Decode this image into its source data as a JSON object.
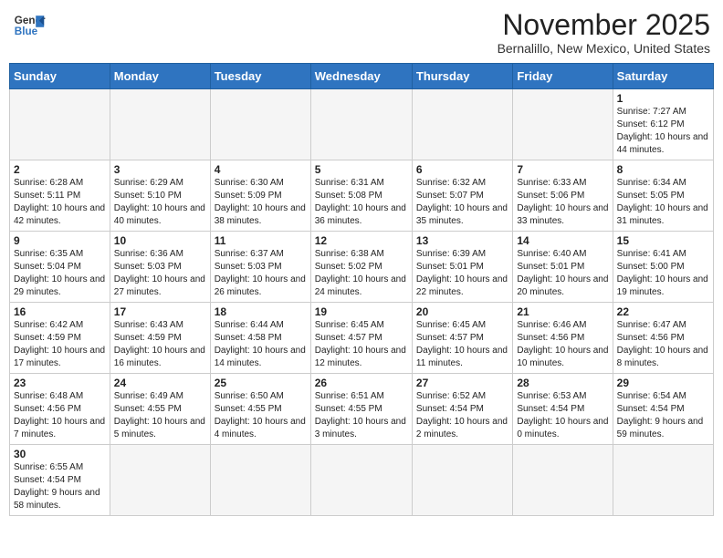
{
  "header": {
    "logo_general": "General",
    "logo_blue": "Blue",
    "month_title": "November 2025",
    "location": "Bernalillo, New Mexico, United States"
  },
  "days_of_week": [
    "Sunday",
    "Monday",
    "Tuesday",
    "Wednesday",
    "Thursday",
    "Friday",
    "Saturday"
  ],
  "weeks": [
    [
      {
        "day": "",
        "info": ""
      },
      {
        "day": "",
        "info": ""
      },
      {
        "day": "",
        "info": ""
      },
      {
        "day": "",
        "info": ""
      },
      {
        "day": "",
        "info": ""
      },
      {
        "day": "",
        "info": ""
      },
      {
        "day": "1",
        "info": "Sunrise: 7:27 AM\nSunset: 6:12 PM\nDaylight: 10 hours and 44 minutes."
      }
    ],
    [
      {
        "day": "2",
        "info": "Sunrise: 6:28 AM\nSunset: 5:11 PM\nDaylight: 10 hours and 42 minutes."
      },
      {
        "day": "3",
        "info": "Sunrise: 6:29 AM\nSunset: 5:10 PM\nDaylight: 10 hours and 40 minutes."
      },
      {
        "day": "4",
        "info": "Sunrise: 6:30 AM\nSunset: 5:09 PM\nDaylight: 10 hours and 38 minutes."
      },
      {
        "day": "5",
        "info": "Sunrise: 6:31 AM\nSunset: 5:08 PM\nDaylight: 10 hours and 36 minutes."
      },
      {
        "day": "6",
        "info": "Sunrise: 6:32 AM\nSunset: 5:07 PM\nDaylight: 10 hours and 35 minutes."
      },
      {
        "day": "7",
        "info": "Sunrise: 6:33 AM\nSunset: 5:06 PM\nDaylight: 10 hours and 33 minutes."
      },
      {
        "day": "8",
        "info": "Sunrise: 6:34 AM\nSunset: 5:05 PM\nDaylight: 10 hours and 31 minutes."
      }
    ],
    [
      {
        "day": "9",
        "info": "Sunrise: 6:35 AM\nSunset: 5:04 PM\nDaylight: 10 hours and 29 minutes."
      },
      {
        "day": "10",
        "info": "Sunrise: 6:36 AM\nSunset: 5:03 PM\nDaylight: 10 hours and 27 minutes."
      },
      {
        "day": "11",
        "info": "Sunrise: 6:37 AM\nSunset: 5:03 PM\nDaylight: 10 hours and 26 minutes."
      },
      {
        "day": "12",
        "info": "Sunrise: 6:38 AM\nSunset: 5:02 PM\nDaylight: 10 hours and 24 minutes."
      },
      {
        "day": "13",
        "info": "Sunrise: 6:39 AM\nSunset: 5:01 PM\nDaylight: 10 hours and 22 minutes."
      },
      {
        "day": "14",
        "info": "Sunrise: 6:40 AM\nSunset: 5:01 PM\nDaylight: 10 hours and 20 minutes."
      },
      {
        "day": "15",
        "info": "Sunrise: 6:41 AM\nSunset: 5:00 PM\nDaylight: 10 hours and 19 minutes."
      }
    ],
    [
      {
        "day": "16",
        "info": "Sunrise: 6:42 AM\nSunset: 4:59 PM\nDaylight: 10 hours and 17 minutes."
      },
      {
        "day": "17",
        "info": "Sunrise: 6:43 AM\nSunset: 4:59 PM\nDaylight: 10 hours and 16 minutes."
      },
      {
        "day": "18",
        "info": "Sunrise: 6:44 AM\nSunset: 4:58 PM\nDaylight: 10 hours and 14 minutes."
      },
      {
        "day": "19",
        "info": "Sunrise: 6:45 AM\nSunset: 4:57 PM\nDaylight: 10 hours and 12 minutes."
      },
      {
        "day": "20",
        "info": "Sunrise: 6:45 AM\nSunset: 4:57 PM\nDaylight: 10 hours and 11 minutes."
      },
      {
        "day": "21",
        "info": "Sunrise: 6:46 AM\nSunset: 4:56 PM\nDaylight: 10 hours and 10 minutes."
      },
      {
        "day": "22",
        "info": "Sunrise: 6:47 AM\nSunset: 4:56 PM\nDaylight: 10 hours and 8 minutes."
      }
    ],
    [
      {
        "day": "23",
        "info": "Sunrise: 6:48 AM\nSunset: 4:56 PM\nDaylight: 10 hours and 7 minutes."
      },
      {
        "day": "24",
        "info": "Sunrise: 6:49 AM\nSunset: 4:55 PM\nDaylight: 10 hours and 5 minutes."
      },
      {
        "day": "25",
        "info": "Sunrise: 6:50 AM\nSunset: 4:55 PM\nDaylight: 10 hours and 4 minutes."
      },
      {
        "day": "26",
        "info": "Sunrise: 6:51 AM\nSunset: 4:55 PM\nDaylight: 10 hours and 3 minutes."
      },
      {
        "day": "27",
        "info": "Sunrise: 6:52 AM\nSunset: 4:54 PM\nDaylight: 10 hours and 2 minutes."
      },
      {
        "day": "28",
        "info": "Sunrise: 6:53 AM\nSunset: 4:54 PM\nDaylight: 10 hours and 0 minutes."
      },
      {
        "day": "29",
        "info": "Sunrise: 6:54 AM\nSunset: 4:54 PM\nDaylight: 9 hours and 59 minutes."
      }
    ],
    [
      {
        "day": "30",
        "info": "Sunrise: 6:55 AM\nSunset: 4:54 PM\nDaylight: 9 hours and 58 minutes."
      },
      {
        "day": "",
        "info": ""
      },
      {
        "day": "",
        "info": ""
      },
      {
        "day": "",
        "info": ""
      },
      {
        "day": "",
        "info": ""
      },
      {
        "day": "",
        "info": ""
      },
      {
        "day": "",
        "info": ""
      }
    ]
  ]
}
